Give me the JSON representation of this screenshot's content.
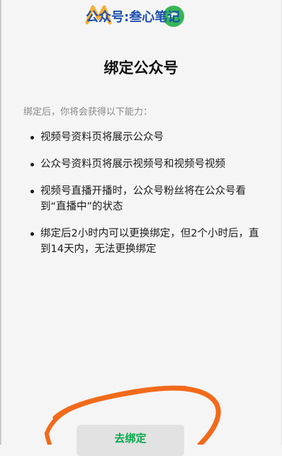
{
  "watermark": {
    "text": "公众号:叁心笔记"
  },
  "page": {
    "title": "绑定公众号",
    "intro": "绑定后，你将会获得以下能力："
  },
  "features": [
    "视频号资料页将展示公众号",
    "公众号资料页将展示视频号和视频号视频",
    "视频号直播开播时，公众号粉丝将在公众号看到“直播中”的状态",
    "绑定后2小时内可以更换绑定，但2个小时后，直到14天内，无法更换绑定"
  ],
  "actions": {
    "bind_label": "去绑定"
  },
  "colors": {
    "background": "#f5f5f5",
    "accent_green": "#07a84b",
    "annotation_orange": "#f26a1b",
    "watermark_blue": "#1b4fb0"
  }
}
